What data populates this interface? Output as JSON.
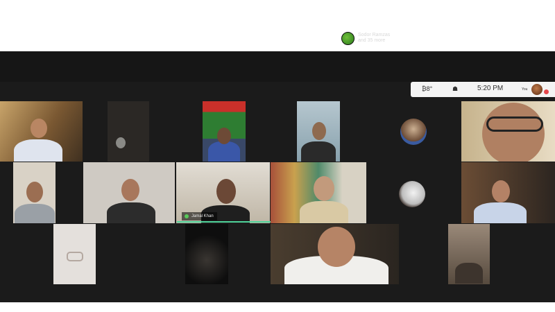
{
  "meeting": {
    "participants_chip": {
      "line1": "Sodor Ramzas",
      "line2": "and 35 more"
    },
    "status": {
      "a": "₿8°",
      "b": "☗",
      "time": "5:20 PM",
      "small": "You"
    },
    "active_speaker": {
      "name": "Jamal Khan"
    }
  },
  "colors": {
    "background": "#1b1b1b",
    "speaker_highlight": "#4fd39a",
    "alert": "#e5484d"
  }
}
